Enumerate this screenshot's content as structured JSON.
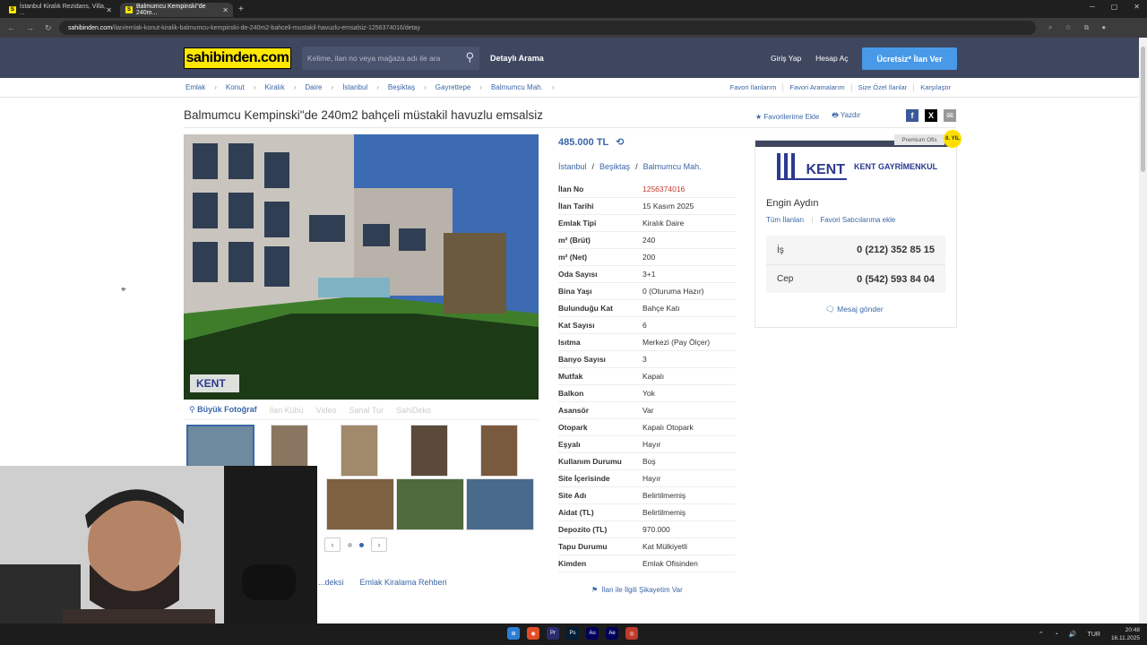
{
  "browser": {
    "tabs": [
      {
        "label": "İstanbul Kiralık Rezidans, Villa, ..."
      },
      {
        "label": "Balmumcu Kempinski\"de 240m..."
      }
    ],
    "url_domain": "sahibinden.com",
    "url_path": "/ilan/emlak-konut-kiralik-balmumcu-kempinski-de-240m2-bahceli-mustakil-havuzlu-emsalsiz-1256374016/detay"
  },
  "header": {
    "logo": "sahibinden.com",
    "search_placeholder": "Kelime, ilan no veya mağaza adı ile ara",
    "detailed_search": "Detaylı Arama",
    "login": "Giriş Yap",
    "register": "Hesap Aç",
    "post_ad": "Ücretsiz* İlan Ver"
  },
  "breadcrumbs": [
    "Emlak",
    "Konut",
    "Kiralık",
    "Daire",
    "İstanbul",
    "Beşiktaş",
    "Gayrettepe",
    "Balmumcu Mah."
  ],
  "right_links": [
    "Favori İlanlarım",
    "Favori Aramalarım",
    "Size Özel İlanlar",
    "Karşılaştır"
  ],
  "listing": {
    "title": "Balmumcu Kempinski\"de 240m2 bahçeli müstakil havuzlu emsalsiz",
    "add_favorite": "Favorilerime Ekle",
    "print": "Yazdır",
    "price": "485.000 TL",
    "location": [
      "İstanbul",
      "Beşiktaş",
      "Balmumcu Mah."
    ],
    "photo_watermark": "KENT",
    "photo_tabs": [
      "Büyük Fotoğraf",
      "İlan Kübü",
      "Video",
      "Sanal Tur",
      "SahiDeko"
    ],
    "complaint": "İlan ile İlgili Şikayetim Var",
    "bottom_links": [
      "...deksi",
      "Emlak Kiralama Rehberi"
    ],
    "details": [
      {
        "k": "İlan No",
        "v": "1256374016"
      },
      {
        "k": "İlan Tarihi",
        "v": "15 Kasım 2025"
      },
      {
        "k": "Emlak Tipi",
        "v": "Kiralık Daire"
      },
      {
        "k": "m² (Brüt)",
        "v": "240"
      },
      {
        "k": "m² (Net)",
        "v": "200"
      },
      {
        "k": "Oda Sayısı",
        "v": "3+1"
      },
      {
        "k": "Bina Yaşı",
        "v": "0 (Oturuma Hazır)"
      },
      {
        "k": "Bulunduğu Kat",
        "v": "Bahçe Katı"
      },
      {
        "k": "Kat Sayısı",
        "v": "6"
      },
      {
        "k": "Isıtma",
        "v": "Merkezi (Pay Ölçer)"
      },
      {
        "k": "Banyo Sayısı",
        "v": "3"
      },
      {
        "k": "Mutfak",
        "v": "Kapalı"
      },
      {
        "k": "Balkon",
        "v": "Yok"
      },
      {
        "k": "Asansör",
        "v": "Var"
      },
      {
        "k": "Otopark",
        "v": "Kapalı Otopark"
      },
      {
        "k": "Eşyalı",
        "v": "Hayır"
      },
      {
        "k": "Kullanım Durumu",
        "v": "Boş"
      },
      {
        "k": "Site İçerisinde",
        "v": "Hayır"
      },
      {
        "k": "Site Adı",
        "v": "Belirtilmemiş"
      },
      {
        "k": "Aidat (TL)",
        "v": "Belirtilmemiş"
      },
      {
        "k": "Depozito (TL)",
        "v": "970.000"
      },
      {
        "k": "Tapu Durumu",
        "v": "Kat Mülkiyetli"
      },
      {
        "k": "Kimden",
        "v": "Emlak Ofisinden"
      }
    ]
  },
  "seller": {
    "premium": "Premium Ofis",
    "badge": "8. YIL",
    "logo_text": "KENT",
    "company": "KENT GAYRİMENKUL",
    "person": "Engin Aydın",
    "all_ads": "Tüm İlanları",
    "fav_seller": "Favori Satıcılarıma ekle",
    "phones": [
      {
        "label": "İş",
        "number": "0 (212) 352 85 15"
      },
      {
        "label": "Cep",
        "number": "0 (542) 593 84 04"
      }
    ],
    "message": "Mesaj gönder"
  },
  "taskbar": {
    "lang": "TUR",
    "time": "20:48",
    "date": "16.11.2025"
  }
}
